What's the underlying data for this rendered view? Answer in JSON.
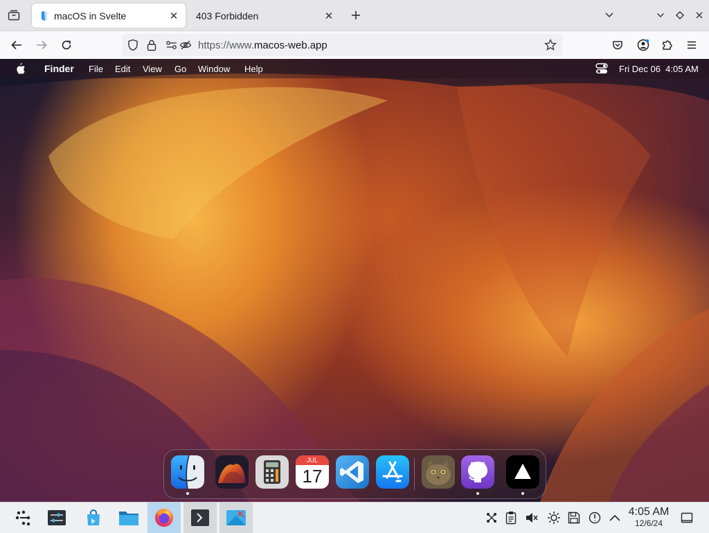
{
  "browser": {
    "tabs": [
      {
        "title": "macOS in Svelte",
        "active": true
      },
      {
        "title": "403 Forbidden",
        "active": false
      }
    ],
    "url": {
      "scheme": "https://www.",
      "host": "macos-web.app"
    }
  },
  "macos": {
    "menubar": {
      "app_name": "Finder",
      "menus": [
        "File",
        "Edit",
        "View",
        "Go",
        "Window",
        "Help"
      ],
      "datetime": "Fri Dec 06  4:05 AM"
    },
    "dock": {
      "calendar_month": "JUL",
      "calendar_day": "17",
      "apps": [
        {
          "name": "finder",
          "running": true
        },
        {
          "name": "wallpapers",
          "running": false
        },
        {
          "name": "calculator",
          "running": false
        },
        {
          "name": "calendar",
          "running": false
        },
        {
          "name": "vscode",
          "running": false
        },
        {
          "name": "app-store",
          "running": false
        },
        {
          "name": "cat-photo",
          "running": false
        },
        {
          "name": "github",
          "running": true
        },
        {
          "name": "vercel",
          "running": true
        }
      ]
    }
  },
  "taskbar": {
    "time": "4:05 AM",
    "date": "12/6/24",
    "colors": {
      "active_task": "#b7d6ef",
      "bg": "#eff0f1"
    }
  }
}
